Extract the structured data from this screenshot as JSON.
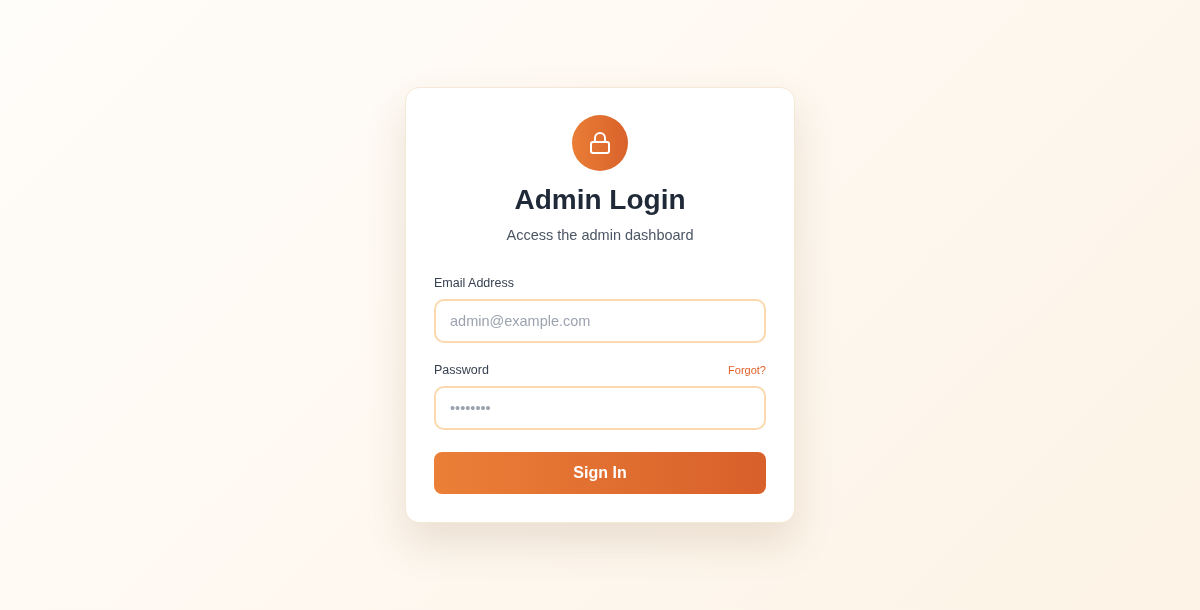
{
  "title": "Admin Login",
  "subtitle": "Access the admin dashboard",
  "fields": [
    {
      "label": "Email Address",
      "placeholder": "admin@example.com"
    },
    {
      "label": "Password",
      "placeholder": "••••••••",
      "link": "Forgot?"
    }
  ],
  "submit": "Sign In"
}
